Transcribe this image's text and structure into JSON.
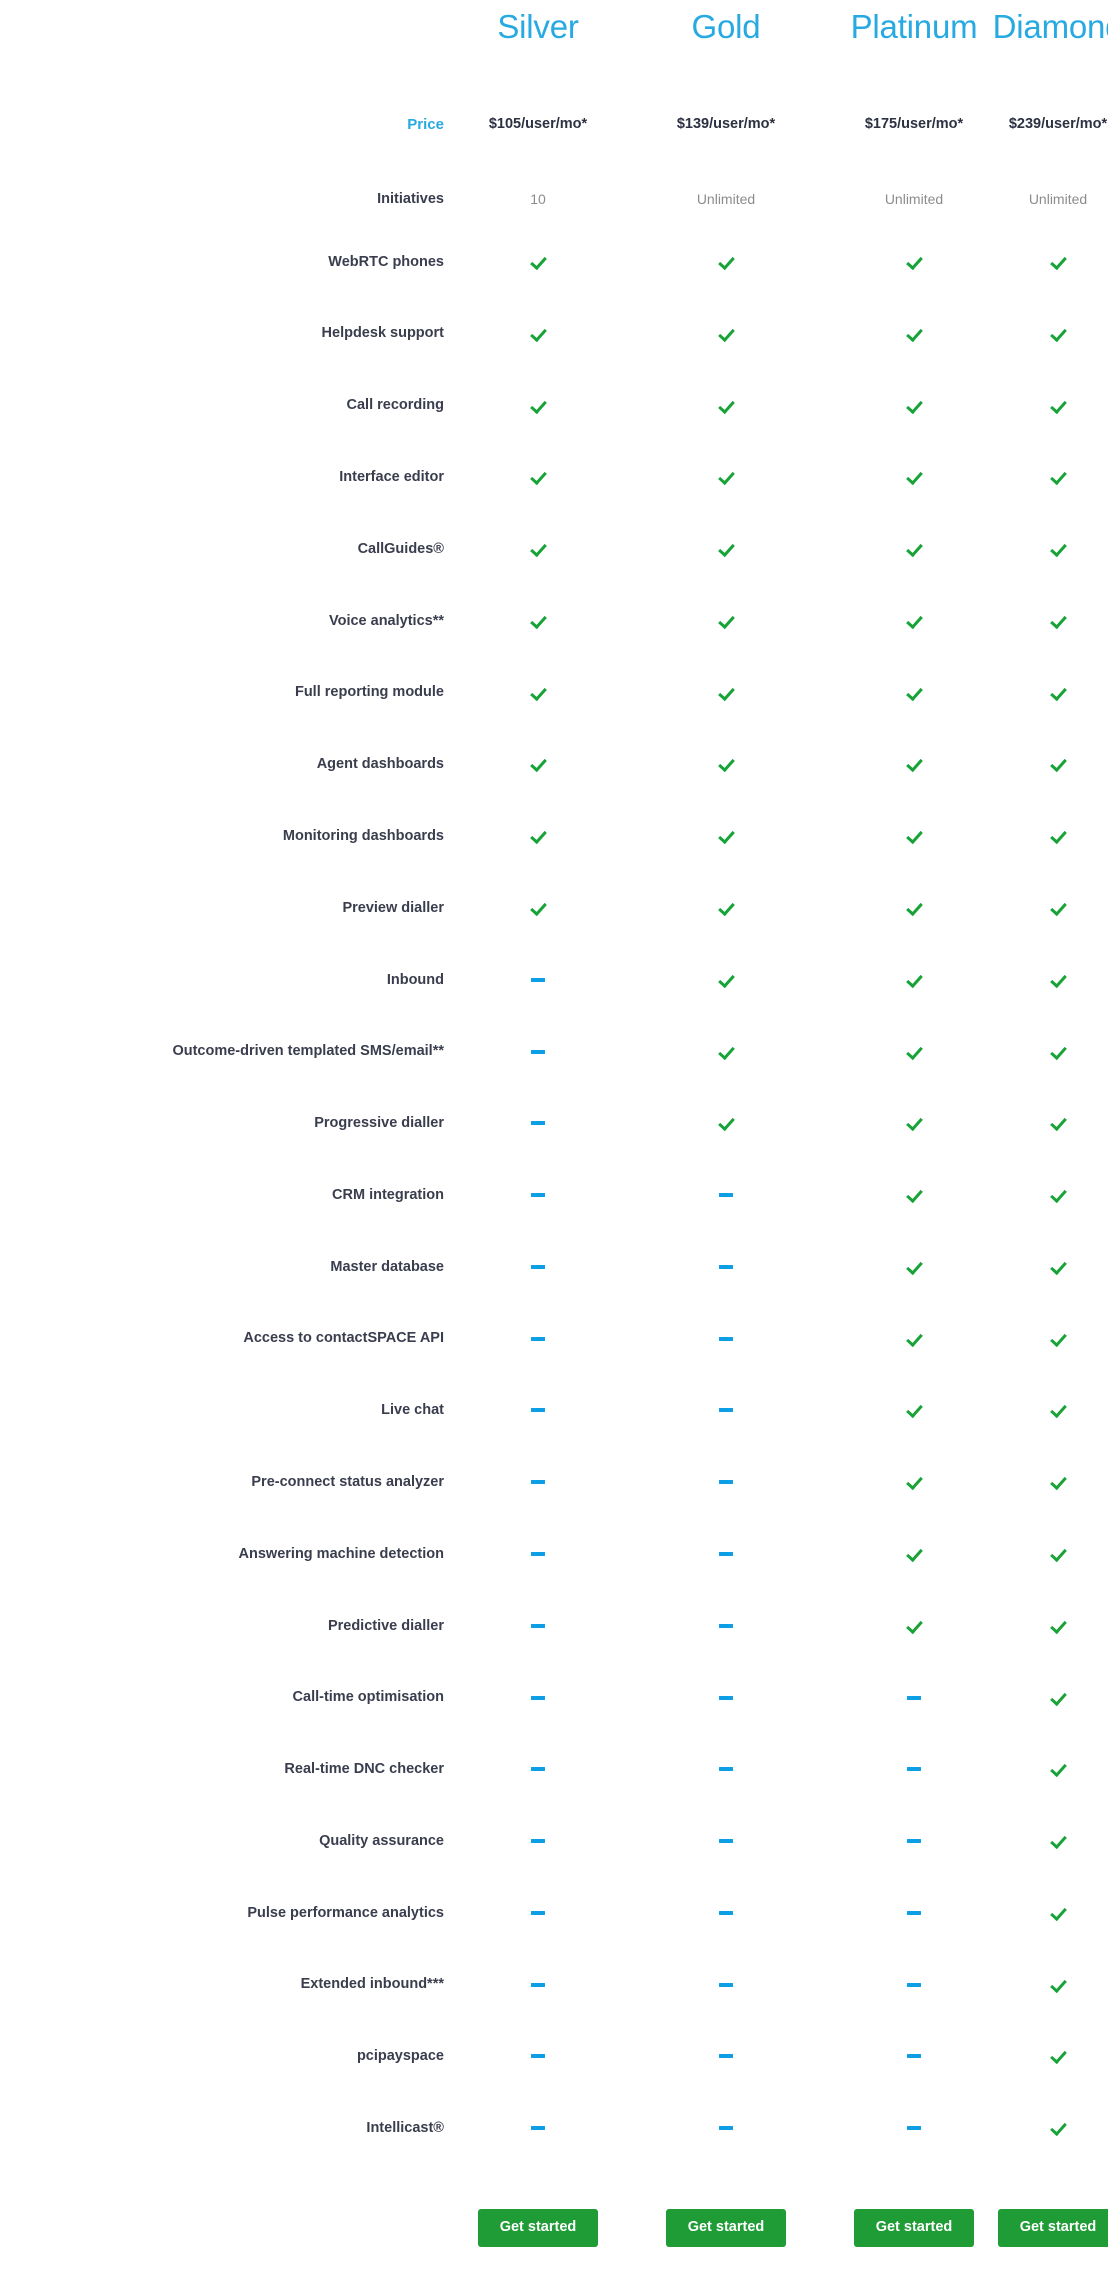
{
  "table": {
    "row_label_header": "",
    "price_row_label": "Price",
    "initiatives_row_label": "Initiatives",
    "accent_blue": "#27a9e1",
    "dash_blue": "#0d9fe6",
    "tick_green": "#17a337",
    "button_green": "#1f9c35",
    "label_color": "#3a3d4d",
    "muted_color": "#8c8c8c",
    "plans": [
      {
        "name": "Silver",
        "price": "$105/user/mo*",
        "initiatives": "10",
        "cta": "Get started"
      },
      {
        "name": "Gold",
        "price": "$139/user/mo*",
        "initiatives": "Unlimited",
        "cta": "Get started"
      },
      {
        "name": "Platinum",
        "price": "$175/user/mo*",
        "initiatives": "Unlimited",
        "cta": "Get started"
      },
      {
        "name": "Diamond",
        "price": "$239/user/mo*",
        "initiatives": "Unlimited",
        "cta": "Get started"
      }
    ],
    "features": [
      {
        "label": "WebRTC phones",
        "values": [
          "check",
          "check",
          "check",
          "check"
        ]
      },
      {
        "label": "Helpdesk support",
        "values": [
          "check",
          "check",
          "check",
          "check"
        ]
      },
      {
        "label": "Call recording",
        "values": [
          "check",
          "check",
          "check",
          "check"
        ]
      },
      {
        "label": "Interface editor",
        "values": [
          "check",
          "check",
          "check",
          "check"
        ]
      },
      {
        "label": "CallGuides®",
        "values": [
          "check",
          "check",
          "check",
          "check"
        ]
      },
      {
        "label": "Voice analytics**",
        "values": [
          "check",
          "check",
          "check",
          "check"
        ]
      },
      {
        "label": "Full reporting module",
        "values": [
          "check",
          "check",
          "check",
          "check"
        ]
      },
      {
        "label": "Agent dashboards",
        "values": [
          "check",
          "check",
          "check",
          "check"
        ]
      },
      {
        "label": "Monitoring dashboards",
        "values": [
          "check",
          "check",
          "check",
          "check"
        ]
      },
      {
        "label": "Preview dialler",
        "values": [
          "check",
          "check",
          "check",
          "check"
        ]
      },
      {
        "label": "Inbound",
        "values": [
          "dash",
          "check",
          "check",
          "check"
        ]
      },
      {
        "label": "Outcome-driven templated SMS/email**",
        "values": [
          "dash",
          "check",
          "check",
          "check"
        ]
      },
      {
        "label": "Progressive dialler",
        "values": [
          "dash",
          "check",
          "check",
          "check"
        ]
      },
      {
        "label": "CRM integration",
        "values": [
          "dash",
          "dash",
          "check",
          "check"
        ]
      },
      {
        "label": "Master database",
        "values": [
          "dash",
          "dash",
          "check",
          "check"
        ]
      },
      {
        "label": "Access to contactSPACE API",
        "values": [
          "dash",
          "dash",
          "check",
          "check"
        ]
      },
      {
        "label": "Live chat",
        "values": [
          "dash",
          "dash",
          "check",
          "check"
        ]
      },
      {
        "label": "Pre-connect status analyzer",
        "values": [
          "dash",
          "dash",
          "check",
          "check"
        ]
      },
      {
        "label": "Answering machine detection",
        "values": [
          "dash",
          "dash",
          "check",
          "check"
        ]
      },
      {
        "label": "Predictive dialler",
        "values": [
          "dash",
          "dash",
          "check",
          "check"
        ]
      },
      {
        "label": "Call-time optimisation",
        "values": [
          "dash",
          "dash",
          "dash",
          "check"
        ]
      },
      {
        "label": "Real-time DNC checker",
        "values": [
          "dash",
          "dash",
          "dash",
          "check"
        ]
      },
      {
        "label": "Quality assurance",
        "values": [
          "dash",
          "dash",
          "dash",
          "check"
        ]
      },
      {
        "label": "Pulse performance analytics",
        "values": [
          "dash",
          "dash",
          "dash",
          "check"
        ]
      },
      {
        "label": "Extended inbound***",
        "values": [
          "dash",
          "dash",
          "dash",
          "check"
        ]
      },
      {
        "label": "pcipayspace",
        "values": [
          "dash",
          "dash",
          "dash",
          "check"
        ]
      },
      {
        "label": "Intellicast®",
        "values": [
          "dash",
          "dash",
          "dash",
          "check"
        ]
      }
    ]
  }
}
